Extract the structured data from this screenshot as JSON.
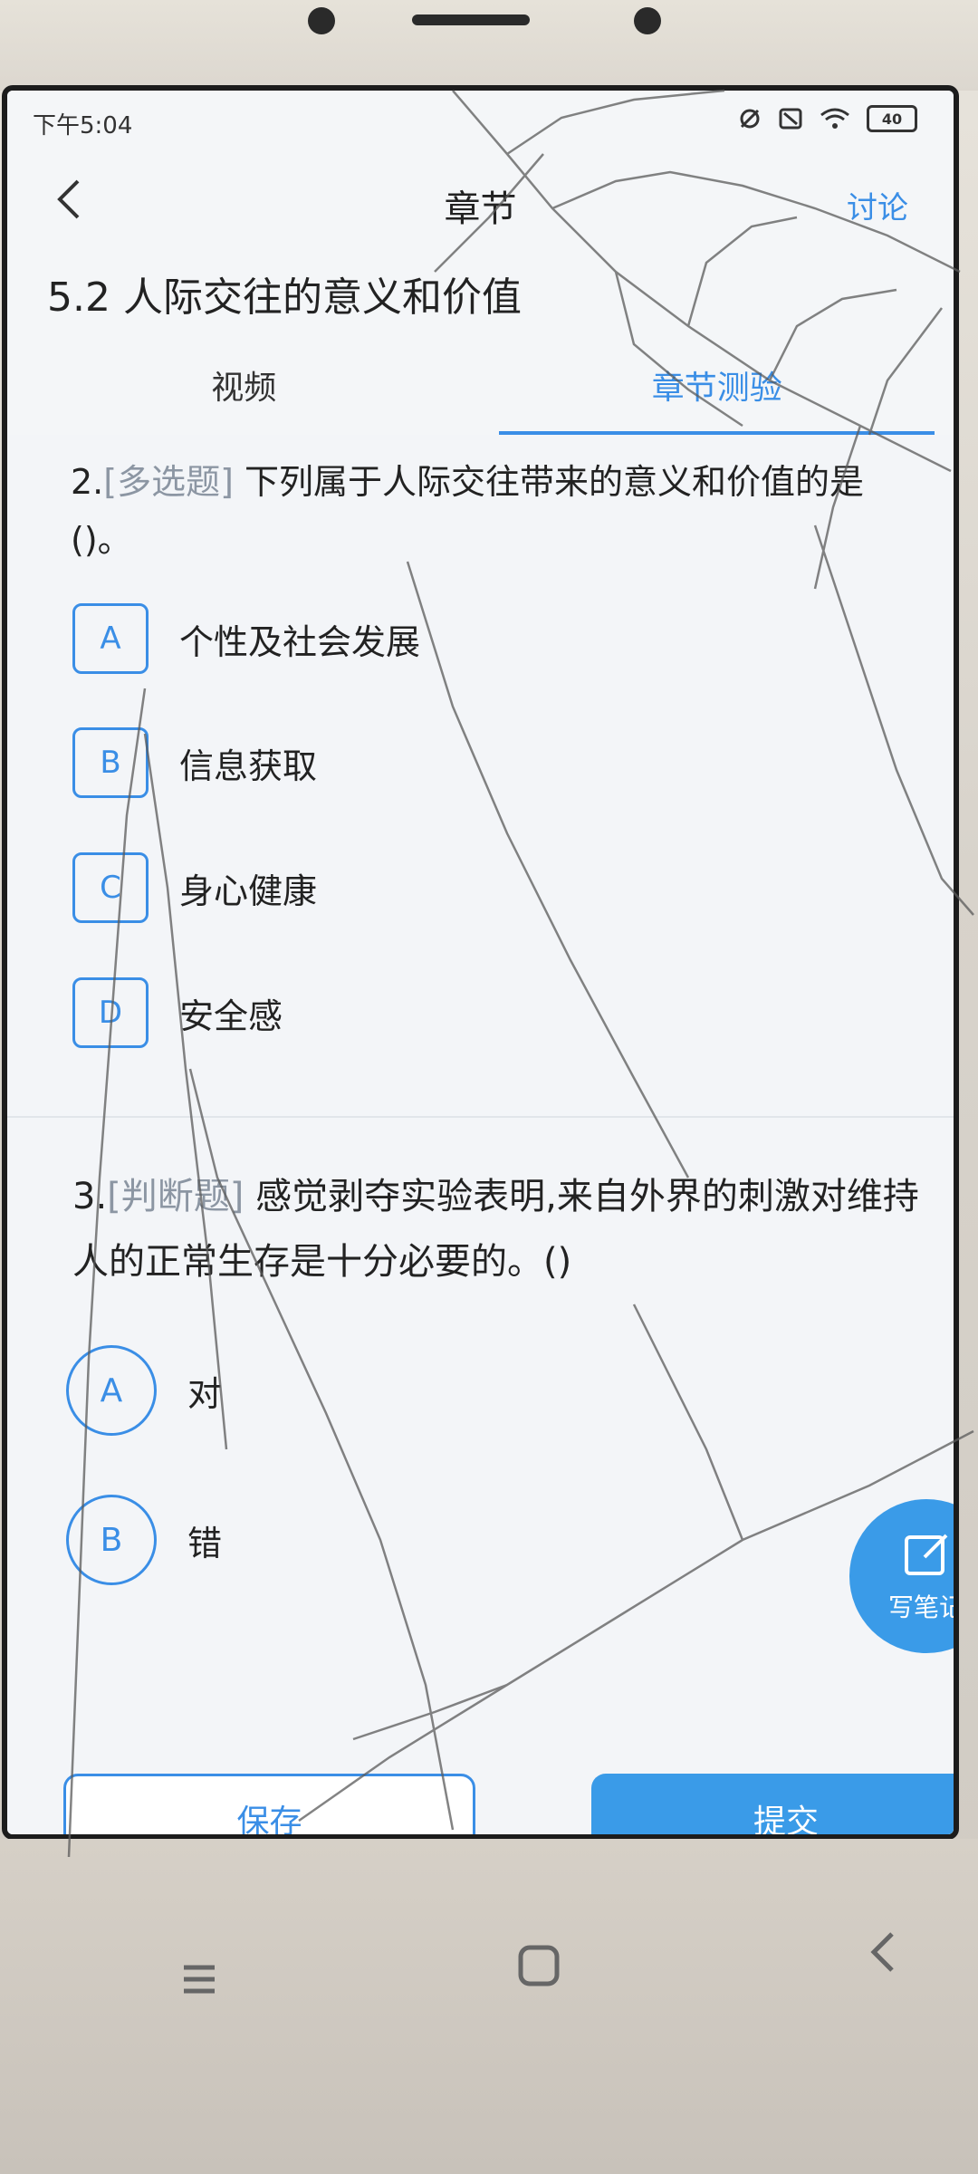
{
  "status_bar": {
    "time": "下午5:04",
    "battery": "40"
  },
  "nav": {
    "title": "章节",
    "action": "讨论"
  },
  "chapter": {
    "title": "5.2 人际交往的意义和价值"
  },
  "tabs": [
    {
      "label": "视频"
    },
    {
      "label": "章节测验"
    }
  ],
  "questions": [
    {
      "number": "2.",
      "type": "[多选题]",
      "text": "下列属于人际交往带来的意义和价值的是()。",
      "options": [
        {
          "letter": "A",
          "label": "个性及社会发展"
        },
        {
          "letter": "B",
          "label": "信息获取"
        },
        {
          "letter": "C",
          "label": "身心健康"
        },
        {
          "letter": "D",
          "label": "安全感"
        }
      ]
    },
    {
      "number": "3.",
      "type": "[判断题]",
      "text": "感觉剥夺实验表明,来自外界的刺激对维持人的正常生存是十分必要的。()",
      "options": [
        {
          "letter": "A",
          "label": "对"
        },
        {
          "letter": "B",
          "label": "错"
        }
      ]
    }
  ],
  "fab": {
    "label": "写笔记",
    "icon": "edit-icon"
  },
  "footer": {
    "save_label": "保存",
    "submit_label": "提交"
  },
  "colors": {
    "accent": "#3a8ee6",
    "fab": "#3a9be8"
  }
}
